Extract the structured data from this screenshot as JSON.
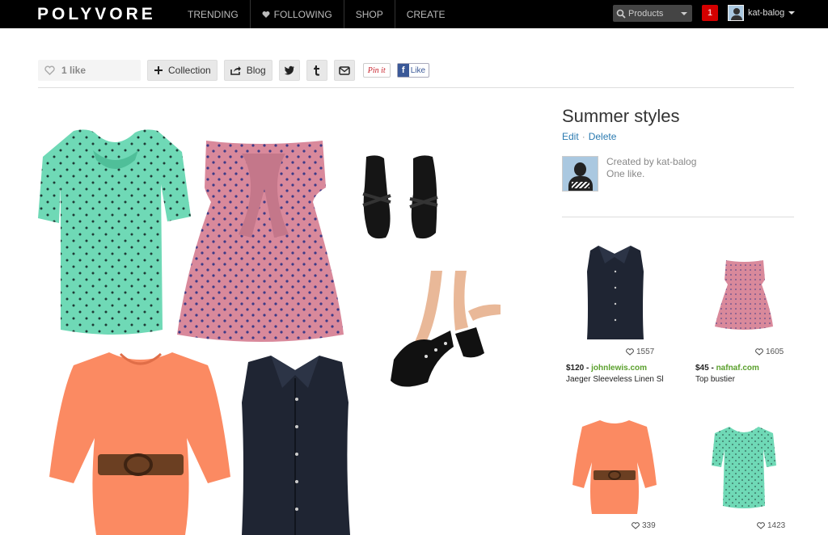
{
  "topbar": {
    "logo": "POLYVORE",
    "nav": [
      "TRENDING",
      "FOLLOWING",
      "SHOP",
      "CREATE"
    ],
    "search_label": "Products",
    "notifications": "1",
    "username": "kat-balog"
  },
  "share": {
    "likes": "1 like",
    "collection": "Collection",
    "blog": "Blog",
    "pinit": "Pin it",
    "fb_like": "Like"
  },
  "set": {
    "title": "Summer styles",
    "edit": "Edit",
    "delete": "Delete",
    "created_by": "Created by kat-balog",
    "likes_text": "One like."
  },
  "products": [
    {
      "likes": "1557",
      "price": "$120",
      "store": "johnlewis.com",
      "name": "Jaeger Sleeveless Linen Shirt"
    },
    {
      "likes": "1605",
      "price": "$45",
      "store": "nafnaf.com",
      "name": "Top bustier"
    },
    {
      "likes": "339"
    },
    {
      "likes": "1423"
    }
  ],
  "colors": {
    "topbar": "#000000",
    "mint": "#6fd9b6",
    "pink": "#d9899b",
    "coral": "#fb8a62",
    "navy": "#1f2533",
    "link": "#2a7ab0",
    "store": "#5aa02c",
    "notif": "#d40000"
  }
}
